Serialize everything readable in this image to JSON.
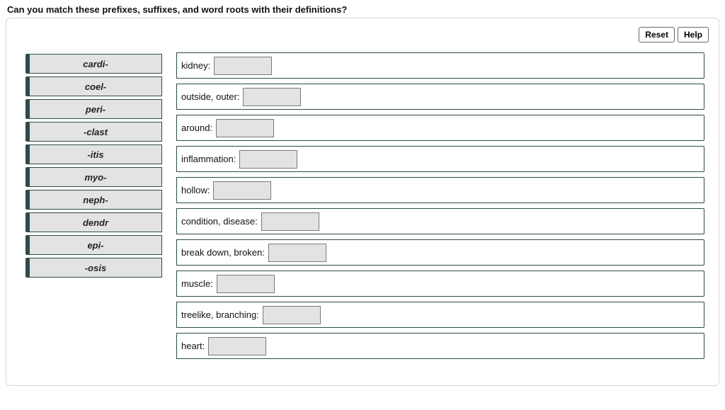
{
  "prompt": "Can you match these prefixes, suffixes, and word roots with their definitions?",
  "toolbar": {
    "reset": "Reset",
    "help": "Help"
  },
  "terms": [
    "cardi-",
    "coel-",
    "peri-",
    "-clast",
    "-itis",
    "myo-",
    "neph-",
    "dendr",
    "epi-",
    "-osis"
  ],
  "definitions": [
    "kidney:",
    "outside, outer:",
    "around:",
    "inflammation:",
    "hollow:",
    "condition, disease:",
    "break down, broken:",
    "muscle:",
    "treelike, branching:",
    "heart:"
  ]
}
